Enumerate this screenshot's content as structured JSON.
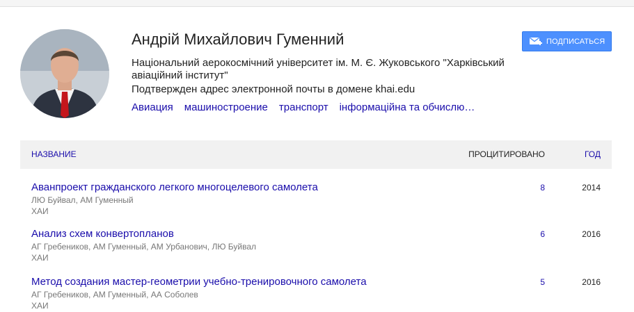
{
  "profile": {
    "name": "Андрій Михайлович Гуменний",
    "affiliation": "Національний аерокосмічний університет ім. М. Є. Жуковського \"Харківський авіаційний інститут\"",
    "verified": "Подтвержден адрес электронной почты в домене khai.edu",
    "interests": [
      "Авиация",
      "машиностроение",
      "транспорт",
      "інформаційна та обчислю…"
    ]
  },
  "follow_button": {
    "label": "ПОДПИСАТЬСЯ",
    "icon": "mail-plus-icon"
  },
  "table": {
    "headers": {
      "title": "НАЗВАНИЕ",
      "cited": "ПРОЦИТИРОВАНО",
      "year": "ГОД"
    },
    "rows": [
      {
        "title": "Аванпроект гражданского легкого многоцелевого самолета",
        "authors": "ЛЮ Буйвал, АМ Гуменный",
        "venue": "ХАИ",
        "cited": "8",
        "year": "2014"
      },
      {
        "title": "Анализ схем конвертопланов",
        "authors": "АГ Гребеников, АМ Гуменный, АМ Урбанович, ЛЮ Буйвал",
        "venue": "ХАИ",
        "cited": "6",
        "year": "2016"
      },
      {
        "title": "Метод создания мастер-геометрии учебно-тренировочного самолета",
        "authors": "АГ Гребеников, АМ Гуменный, АА Соболев",
        "venue": "ХАИ",
        "cited": "5",
        "year": "2016"
      }
    ]
  },
  "colors": {
    "link": "#1a0dab",
    "button": "#4d90fe",
    "header_bg": "#f1f1f1"
  }
}
